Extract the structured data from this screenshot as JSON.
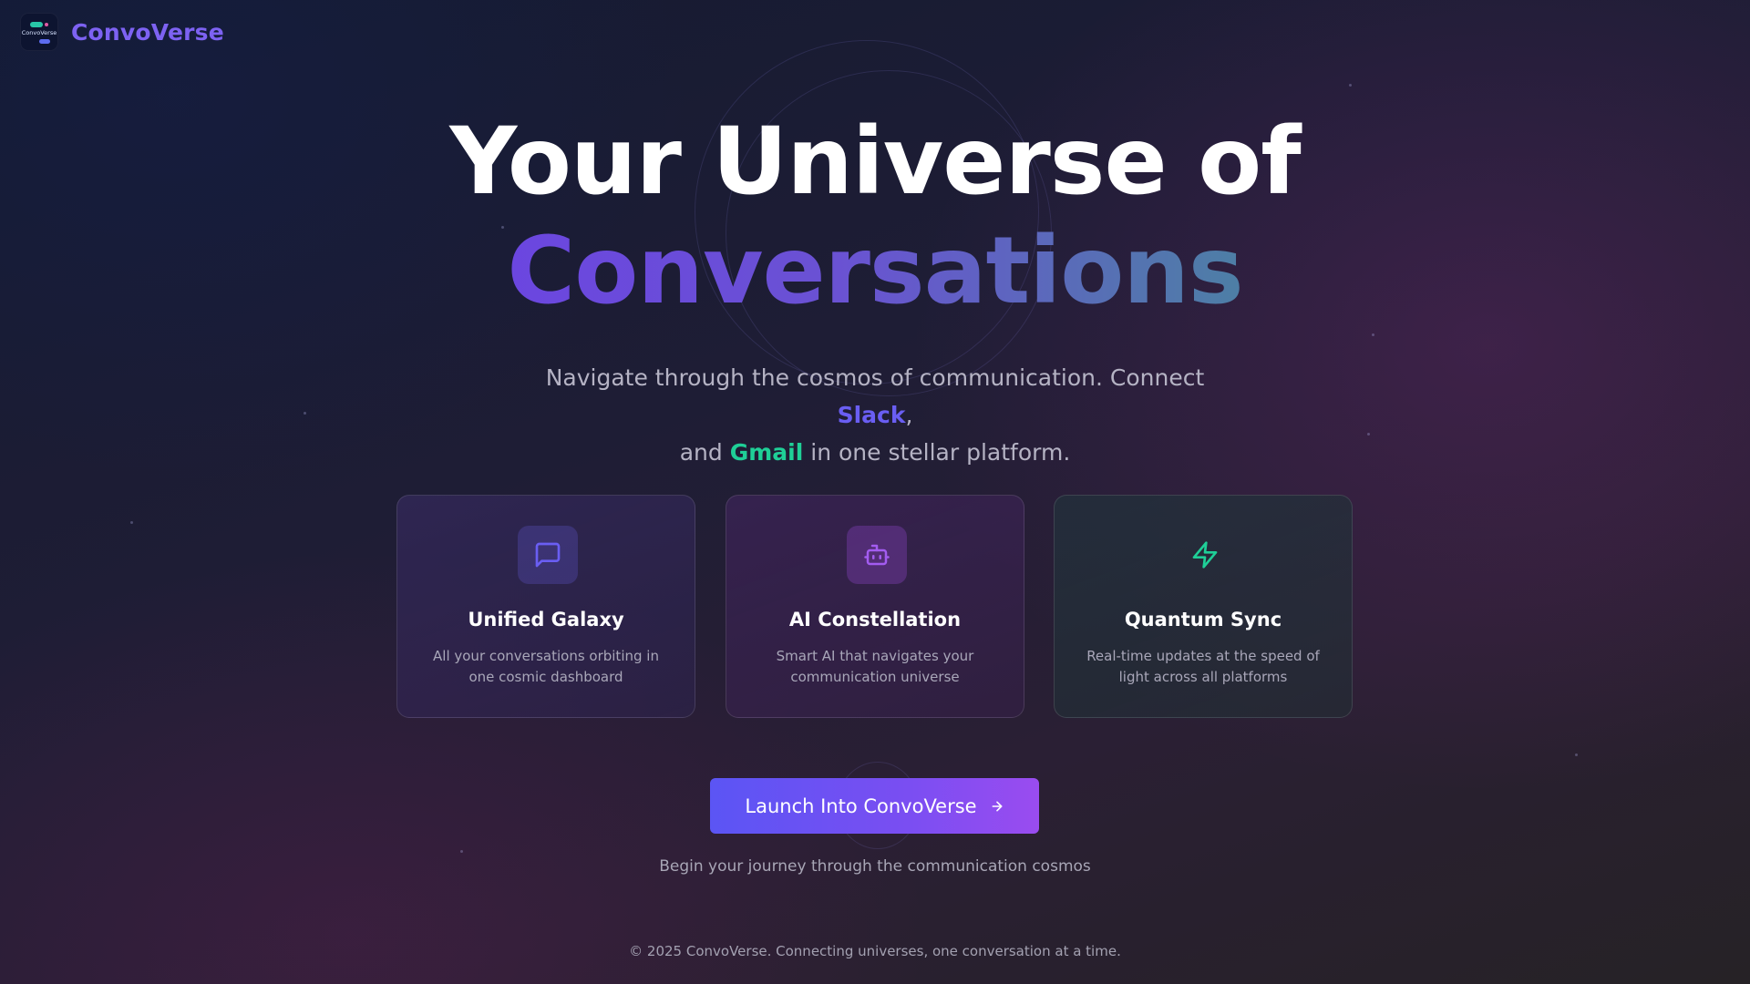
{
  "brand": {
    "logo_text": "ConvoVerse",
    "name": "ConvoVerse"
  },
  "hero": {
    "title_line1": "Your Universe of",
    "title_line2": "Conversations",
    "subtitle": {
      "part1": "Navigate through the cosmos of communication. Connect ",
      "slack": "Slack",
      "part2": ",",
      "part3": "and ",
      "gmail": "Gmail",
      "part4": " in one stellar platform."
    }
  },
  "features": [
    {
      "icon": "message-square-icon",
      "title": "Unified Galaxy",
      "description": "All your conversations orbiting in one cosmic dashboard"
    },
    {
      "icon": "robot-icon",
      "title": "AI Constellation",
      "description": "Smart AI that navigates your communication universe"
    },
    {
      "icon": "lightning-icon",
      "title": "Quantum Sync",
      "description": "Real-time updates at the speed of light across all platforms"
    }
  ],
  "cta": {
    "label": "Launch Into ConvoVerse",
    "icon": "arrow-right-icon",
    "caption": "Begin your journey through the communication cosmos"
  },
  "footer": {
    "text": "© 2025 ConvoVerse. Connecting universes, one conversation at a time."
  },
  "colors": {
    "brand": "#7d62f2",
    "slack": "#6a5ef3",
    "gmail": "#1fcf97",
    "cta_start": "#5b55f4",
    "cta_end": "#9a4cf0"
  }
}
